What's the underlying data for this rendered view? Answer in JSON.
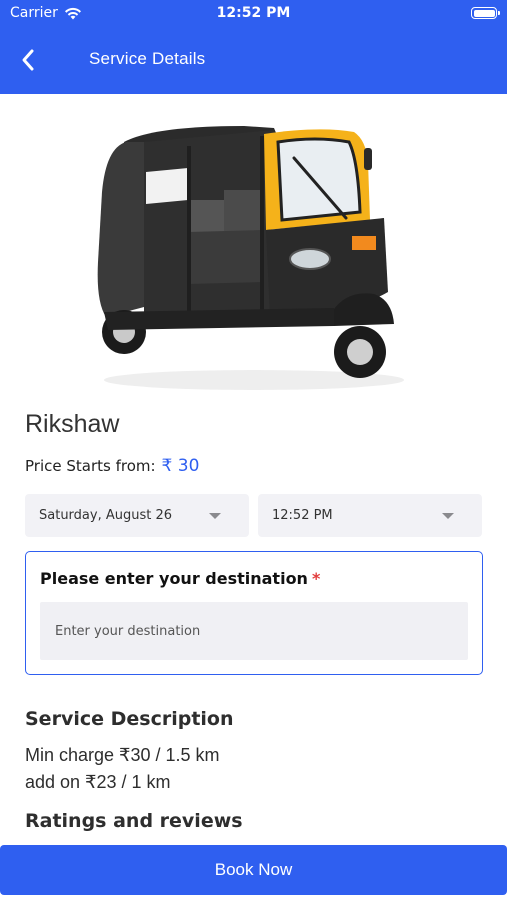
{
  "status_bar": {
    "carrier": "Carrier",
    "time": "12:52 PM"
  },
  "nav": {
    "title": "Service Details",
    "back_icon": "chevron-left-icon"
  },
  "service": {
    "name": "Rikshaw",
    "price_label": "Price Starts from:",
    "price_value": "₹ 30"
  },
  "booking": {
    "date_value": "Saturday, August 26",
    "time_value": "12:52 PM"
  },
  "destination": {
    "label": "Please enter your destination",
    "required_mark": "*",
    "placeholder": "Enter your destination"
  },
  "description": {
    "title": "Service Description",
    "lines": [
      "Min charge ₹30 / 1.5 km",
      "add on ₹23 / 1 km"
    ]
  },
  "reviews": {
    "title": "Ratings and reviews"
  },
  "actions": {
    "book_label": "Book Now"
  },
  "colors": {
    "primary": "#2f5ff0",
    "required": "#e23b3b",
    "field_bg": "#f2f2f6"
  }
}
